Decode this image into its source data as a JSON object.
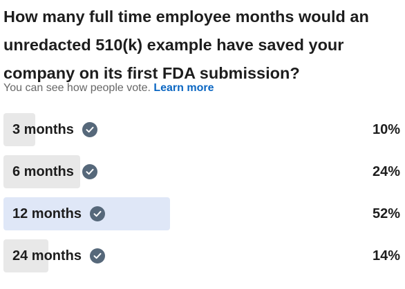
{
  "poll": {
    "question": "How many full time employee months would an unredacted 510(k) example have saved your company on its first FDA submission?",
    "visibility_note": "You can see how people vote.",
    "learn_more_label": "Learn more",
    "options": [
      {
        "label": "3 months",
        "percent_label": "10%",
        "percent": 10,
        "selected": false
      },
      {
        "label": "6 months",
        "percent_label": "24%",
        "percent": 24,
        "selected": false
      },
      {
        "label": "12 months",
        "percent_label": "52%",
        "percent": 52,
        "selected": true
      },
      {
        "label": "24 months",
        "percent_label": "14%",
        "percent": 14,
        "selected": false
      }
    ],
    "colors": {
      "bar": "#e8e8e8",
      "bar_selected": "#dfe7f7",
      "check_icon": "#56687a",
      "link": "#0a66c2"
    },
    "icons": {
      "vote_indicator": "check-circle-icon"
    }
  }
}
